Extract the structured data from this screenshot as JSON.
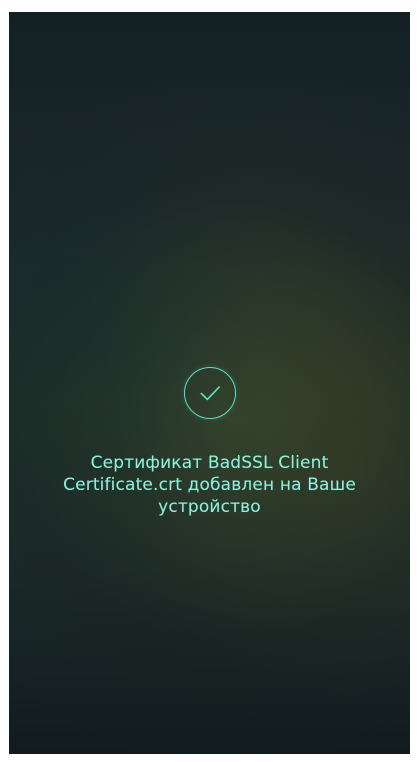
{
  "screen": {
    "status_icon": "check-circle-icon",
    "message": "Сертификат BadSSL Client Certificate.crt добавлен на Ваше устройство"
  },
  "colors": {
    "accent": "#5fe0c5",
    "text": "#8ef0de",
    "background_top": "#132024",
    "background_bottom": "#111b1f"
  }
}
